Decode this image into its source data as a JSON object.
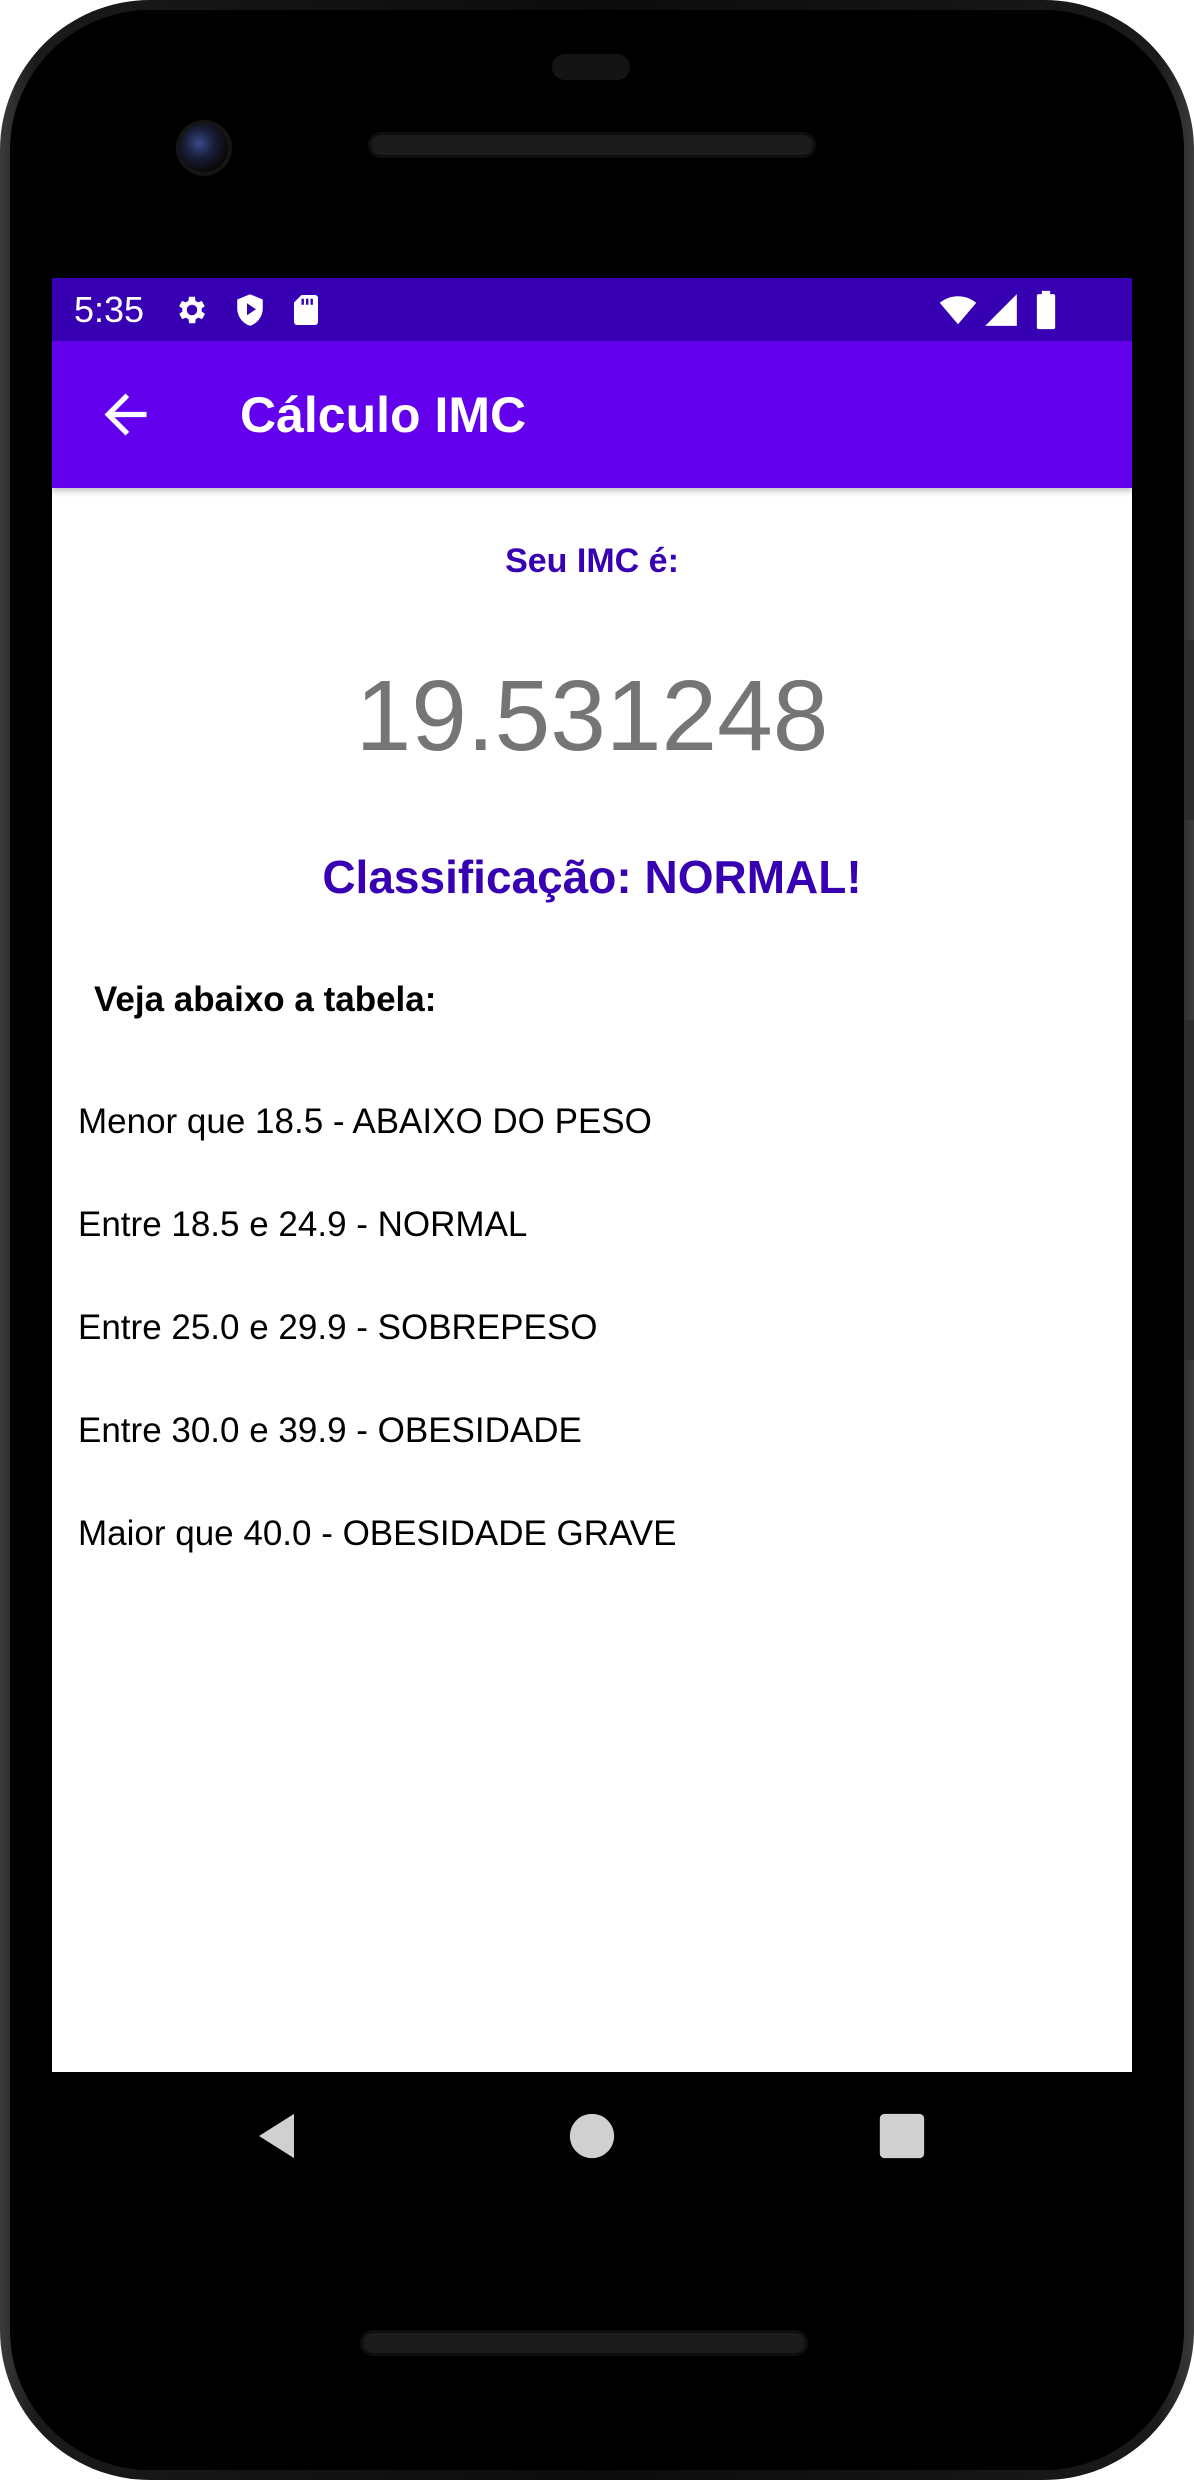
{
  "status_bar": {
    "time": "5:35",
    "left_icons": [
      "gear-icon",
      "shield-play-icon",
      "sd-card-icon"
    ],
    "right_icons": [
      "wifi-icon",
      "cell-signal-icon",
      "battery-icon"
    ],
    "color": "#3700b3"
  },
  "app_bar": {
    "title": "Cálculo IMC",
    "back_icon": "arrow-back-icon",
    "color": "#6200ee"
  },
  "result": {
    "label": "Seu IMC é:",
    "value": "19.531248",
    "classification": "Classificação: NORMAL!"
  },
  "table": {
    "heading": "Veja abaixo a tabela:",
    "items": [
      "Menor que 18.5 - ABAIXO DO PESO",
      "Entre 18.5 e 24.9 - NORMAL",
      "Entre 25.0 e 29.9 - SOBREPESO",
      "Entre 30.0 e 39.9 - OBESIDADE",
      "Maior que 40.0 - OBESIDADE GRAVE"
    ]
  },
  "nav_bar": {
    "buttons": [
      "back-triangle-icon",
      "home-circle-icon",
      "recents-square-icon"
    ]
  }
}
